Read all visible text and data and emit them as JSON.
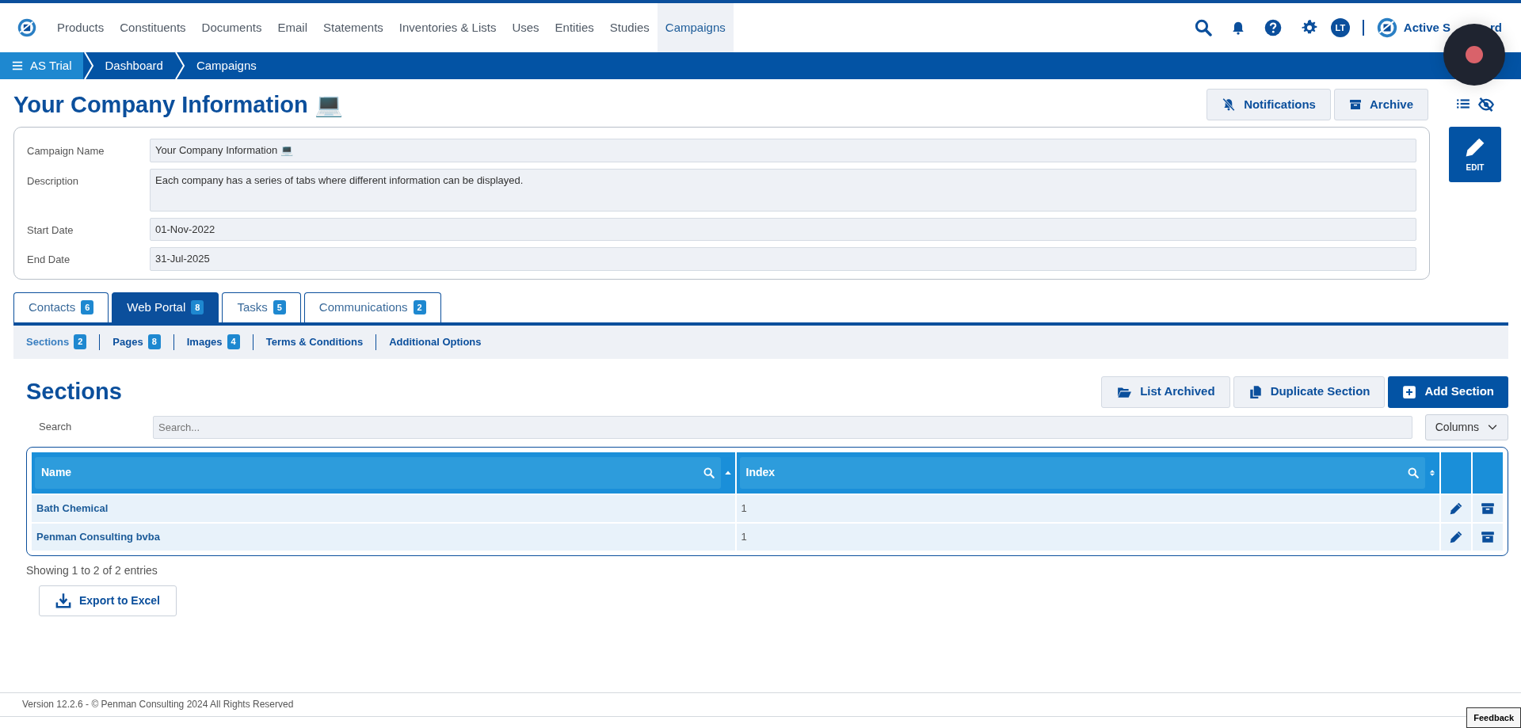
{
  "nav": {
    "items": [
      {
        "label": "Products",
        "selected": false
      },
      {
        "label": "Constituents",
        "selected": false
      },
      {
        "label": "Documents",
        "selected": false
      },
      {
        "label": "Email",
        "selected": false
      },
      {
        "label": "Statements",
        "selected": false
      },
      {
        "label": "Inventories & Lists",
        "selected": false
      },
      {
        "label": "Uses",
        "selected": false
      },
      {
        "label": "Entities",
        "selected": false
      },
      {
        "label": "Studies",
        "selected": false
      },
      {
        "label": "Campaigns",
        "selected": true
      }
    ],
    "avatar": "LT",
    "brand": [
      "Active S",
      "rd"
    ]
  },
  "breadcrumb": [
    "AS Trial",
    "Dashboard",
    "Campaigns"
  ],
  "page": {
    "title": "Your Company Information 💻",
    "buttons": [
      {
        "label": "Notifications",
        "kind": "bell-off"
      },
      {
        "label": "Archive",
        "kind": "archive"
      }
    ],
    "edit": "EDIT"
  },
  "form": [
    {
      "label": "Campaign Name",
      "value": "Your Company Information 💻",
      "kind": "input"
    },
    {
      "label": "Description",
      "value": "Each company has a series of tabs where different information can be displayed.",
      "kind": "textarea"
    },
    {
      "label": "Start Date",
      "value": "01-Nov-2022",
      "kind": "input"
    },
    {
      "label": "End Date",
      "value": "31-Jul-2025",
      "kind": "input"
    }
  ],
  "tabs": [
    {
      "label": "Contacts",
      "count": "6",
      "selected": false
    },
    {
      "label": "Web Portal",
      "count": "8",
      "selected": true
    },
    {
      "label": "Tasks",
      "count": "5",
      "selected": false
    },
    {
      "label": "Communications",
      "count": "2",
      "selected": false
    }
  ],
  "subtabs": [
    {
      "label": "Sections",
      "count": "2",
      "selected": true
    },
    {
      "label": "Pages",
      "count": "8",
      "selected": false
    },
    {
      "label": "Images",
      "count": "4",
      "selected": false
    },
    {
      "label": "Terms & Conditions",
      "selected": false
    },
    {
      "label": "Additional Options",
      "selected": false
    }
  ],
  "section": {
    "title": "Sections",
    "buttons": [
      {
        "label": "List Archived",
        "kind": "folder"
      },
      {
        "label": "Duplicate Section",
        "kind": "copy"
      },
      {
        "label": "Add Section",
        "kind": "add"
      }
    ],
    "search": {
      "label": "Search",
      "placeholder": "Search..."
    },
    "columns_button": "Columns"
  },
  "table": {
    "columns": [
      {
        "label": "Name",
        "sorted": true
      },
      {
        "label": "Index",
        "sorted": false
      }
    ],
    "rows": [
      {
        "cells": [
          "Bath Chemical",
          "1"
        ]
      },
      {
        "cells": [
          "Penman Consulting bvba",
          "1"
        ]
      }
    ]
  },
  "showing": "Showing 1 to 2 of 2 entries",
  "export": "Export to Excel",
  "footer": "Version 12.2.6 - © Penman Consulting 2024 All Rights Reserved",
  "feedback": "Feedback"
}
